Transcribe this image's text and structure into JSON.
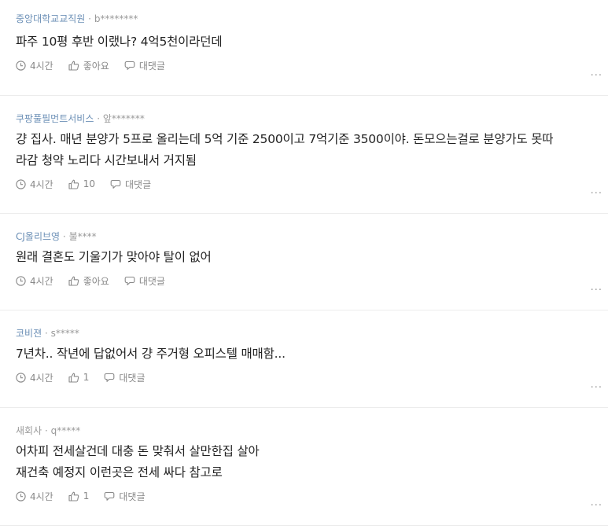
{
  "comments": [
    {
      "company": "중앙대학교교직원",
      "handle": "b********",
      "text": "파주 10평 후반 이랬나? 4억5천이라던데",
      "time": "4시간",
      "likes": "좋아요",
      "reply": "대댓글"
    },
    {
      "company": "쿠팡풀필먼트서비스",
      "handle": "앞*******",
      "text": "걍 집사. 매년 분양가 5프로 올리는데 5억 기준 2500이고 7억기준 3500이야. 돈모으는걸로 분양가도 못따\n라감 청약 노리다 시간보내서 거지됨",
      "time": "4시간",
      "likes": "10",
      "reply": "대댓글"
    },
    {
      "company": "CJ올리브영",
      "handle": "불****",
      "text": "원래 결혼도 기울기가 맞아야 탈이 없어",
      "time": "4시간",
      "likes": "좋아요",
      "reply": "대댓글"
    },
    {
      "company": "코비젼",
      "handle": "s*****",
      "text": "7년차.. 작년에 답없어서 걍 주거형 오피스텔 매매함...",
      "time": "4시간",
      "likes": "1",
      "reply": "대댓글"
    },
    {
      "company": "새회사",
      "handle": "q*****",
      "text": "어차피 전세살건데 대충 돈 맞춰서 살만한집 살아\n재건축 예정지 이런곳은 전세 싸다 참고로",
      "time": "4시간",
      "likes": "1",
      "reply": "대댓글"
    }
  ],
  "separator": "·",
  "more": "...",
  "colors": {
    "company_link": "#6b8fb6",
    "meta_gray": "#888888",
    "divider": "#ececec"
  }
}
